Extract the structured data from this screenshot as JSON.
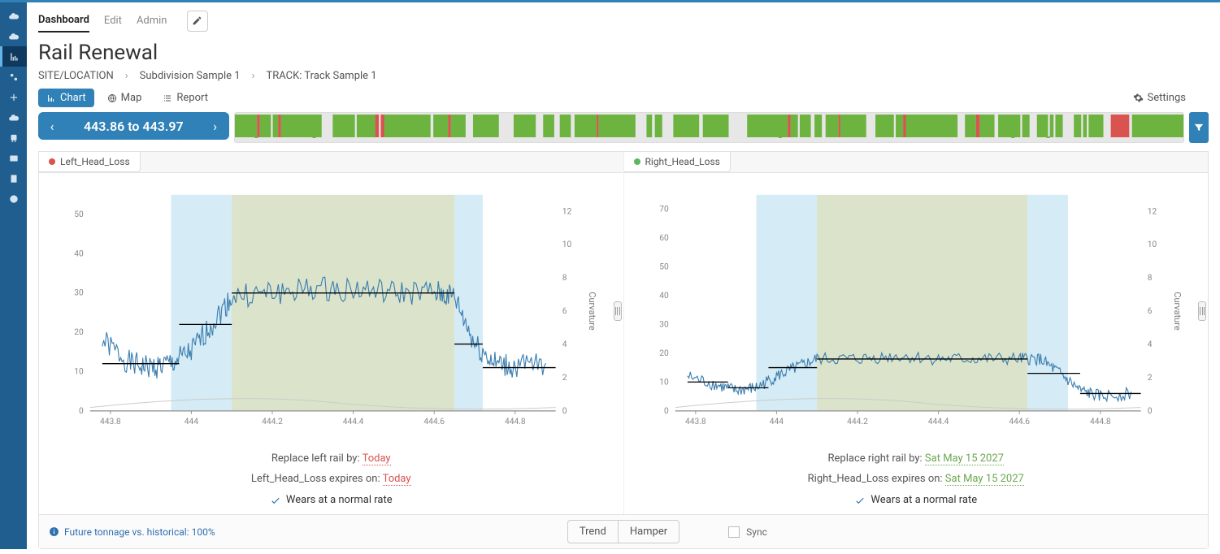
{
  "tabs": {
    "dashboard": "Dashboard",
    "edit": "Edit",
    "admin": "Admin"
  },
  "title": "Rail Renewal",
  "breadcrumb": {
    "site": "SITE/LOCATION",
    "sub": "Subdivision Sample 1",
    "track": "TRACK: Track Sample 1"
  },
  "views": {
    "chart": "Chart",
    "map": "Map",
    "report": "Report"
  },
  "settings": "Settings",
  "range": "443.86 to 443.97",
  "panels": {
    "left": {
      "tab": "Left_Head_Loss",
      "replace_label": "Replace left rail by: ",
      "replace_value": "Today",
      "expires_label": "Left_Head_Loss expires on: ",
      "expires_value": "Today",
      "wears": "Wears at a normal rate"
    },
    "right": {
      "tab": "Right_Head_Loss",
      "replace_label": "Replace right rail by: ",
      "replace_value": "Sat May 15 2027",
      "expires_label": "Right_Head_Loss expires on: ",
      "expires_value": "Sat May 15 2027",
      "wears": "Wears at a normal rate"
    }
  },
  "footer": {
    "info": "Future tonnage vs. historical: 100%",
    "trend": "Trend",
    "hamper": "Hamper",
    "sync": "Sync"
  },
  "right_axis_label": "Curvature",
  "chart_data": [
    {
      "type": "line",
      "title": "Left_Head_Loss",
      "xlabel": "",
      "ylabel": "",
      "x_ticks": [
        443.8,
        444,
        444.2,
        444.4,
        444.6,
        444.8
      ],
      "y_left_ticks": [
        0,
        10,
        20,
        30,
        40,
        50
      ],
      "y_right_ticks": [
        0,
        2,
        4,
        6,
        8,
        10,
        12
      ],
      "y_right_label": "Curvature",
      "xlim": [
        443.75,
        444.9
      ],
      "ylim_left": [
        0,
        55
      ],
      "ylim_right": [
        0,
        13
      ],
      "shaded_bands": [
        {
          "x0": 443.95,
          "x1": 444.1,
          "color": "#c7e4f2"
        },
        {
          "x0": 444.1,
          "x1": 444.65,
          "color": "#cfd9b8"
        },
        {
          "x0": 444.65,
          "x1": 444.72,
          "color": "#c7e4f2"
        }
      ],
      "series": [
        {
          "name": "head_loss_approx",
          "x": [
            443.78,
            443.85,
            443.9,
            443.95,
            444.0,
            444.05,
            444.1,
            444.2,
            444.3,
            444.4,
            444.5,
            444.6,
            444.65,
            444.7,
            444.75,
            444.8,
            444.88
          ],
          "y": [
            18,
            12,
            11,
            12,
            15,
            22,
            29,
            30,
            31,
            31,
            30,
            30,
            29,
            17,
            12,
            11,
            12
          ]
        }
      ],
      "step_segments": [
        {
          "x0": 443.78,
          "x1": 443.97,
          "y": 12
        },
        {
          "x0": 443.97,
          "x1": 444.1,
          "y": 22
        },
        {
          "x0": 444.1,
          "x1": 444.65,
          "y": 30
        },
        {
          "x0": 444.65,
          "x1": 444.72,
          "y": 17
        },
        {
          "x0": 444.72,
          "x1": 444.9,
          "y": 11
        }
      ],
      "baseline_y": 0
    },
    {
      "type": "line",
      "title": "Right_Head_Loss",
      "xlabel": "",
      "ylabel": "",
      "x_ticks": [
        443.8,
        444,
        444.2,
        444.4,
        444.6,
        444.8
      ],
      "y_left_ticks": [
        0,
        10,
        20,
        30,
        40,
        50,
        60,
        70
      ],
      "y_right_ticks": [
        0,
        2,
        4,
        6,
        8,
        10,
        12
      ],
      "y_right_label": "Curvature",
      "xlim": [
        443.75,
        444.9
      ],
      "ylim_left": [
        0,
        75
      ],
      "ylim_right": [
        0,
        13
      ],
      "shaded_bands": [
        {
          "x0": 443.95,
          "x1": 444.1,
          "color": "#c7e4f2"
        },
        {
          "x0": 444.1,
          "x1": 444.62,
          "color": "#cfd9b8"
        },
        {
          "x0": 444.62,
          "x1": 444.72,
          "color": "#c7e4f2"
        }
      ],
      "series": [
        {
          "name": "head_loss_approx",
          "x": [
            443.78,
            443.85,
            443.9,
            443.95,
            444.0,
            444.05,
            444.1,
            444.2,
            444.3,
            444.4,
            444.5,
            444.6,
            444.65,
            444.7,
            444.75,
            444.8,
            444.88
          ],
          "y": [
            12,
            9,
            7,
            8,
            12,
            15,
            18,
            18,
            19,
            18,
            18,
            18,
            18,
            13,
            7,
            5,
            6
          ]
        }
      ],
      "step_segments": [
        {
          "x0": 443.78,
          "x1": 443.88,
          "y": 10
        },
        {
          "x0": 443.88,
          "x1": 443.98,
          "y": 8
        },
        {
          "x0": 443.98,
          "x1": 444.1,
          "y": 15
        },
        {
          "x0": 444.1,
          "x1": 444.62,
          "y": 18
        },
        {
          "x0": 444.62,
          "x1": 444.75,
          "y": 13
        },
        {
          "x0": 444.75,
          "x1": 444.9,
          "y": 6
        }
      ],
      "baseline_y": 0
    }
  ],
  "strip_segments": [
    {
      "w": 1.2,
      "c": "g"
    },
    {
      "w": 0.15,
      "c": "r"
    },
    {
      "w": 0.6,
      "c": "g"
    },
    {
      "w": 0.1,
      "c": "x"
    },
    {
      "w": 0.3,
      "c": "g"
    },
    {
      "w": 0.15,
      "c": "r"
    },
    {
      "w": 2.2,
      "c": "g"
    },
    {
      "w": 0.6,
      "c": "x"
    },
    {
      "w": 1.2,
      "c": "g"
    },
    {
      "w": 0.1,
      "c": "x"
    },
    {
      "w": 1.0,
      "c": "g"
    },
    {
      "w": 0.2,
      "c": "r"
    },
    {
      "w": 0.1,
      "c": "x"
    },
    {
      "w": 0.2,
      "c": "r"
    },
    {
      "w": 2.5,
      "c": "g"
    },
    {
      "w": 0.15,
      "c": "x"
    },
    {
      "w": 0.8,
      "c": "g"
    },
    {
      "w": 0.15,
      "c": "r"
    },
    {
      "w": 0.8,
      "c": "g"
    },
    {
      "w": 0.4,
      "c": "x"
    },
    {
      "w": 1.4,
      "c": "g"
    },
    {
      "w": 0.8,
      "c": "x"
    },
    {
      "w": 1.2,
      "c": "g"
    },
    {
      "w": 0.4,
      "c": "x"
    },
    {
      "w": 0.6,
      "c": "g"
    },
    {
      "w": 0.3,
      "c": "x"
    },
    {
      "w": 0.6,
      "c": "g"
    },
    {
      "w": 0.2,
      "c": "x"
    },
    {
      "w": 1.2,
      "c": "g"
    },
    {
      "w": 0.1,
      "c": "r"
    },
    {
      "w": 2.0,
      "c": "g"
    },
    {
      "w": 0.6,
      "c": "x"
    },
    {
      "w": 0.3,
      "c": "g"
    },
    {
      "w": 0.15,
      "c": "x"
    },
    {
      "w": 0.4,
      "c": "g"
    },
    {
      "w": 0.6,
      "c": "x"
    },
    {
      "w": 1.4,
      "c": "g"
    },
    {
      "w": 0.2,
      "c": "x"
    },
    {
      "w": 1.4,
      "c": "g"
    },
    {
      "w": 1.0,
      "c": "x"
    },
    {
      "w": 2.2,
      "c": "g"
    },
    {
      "w": 0.15,
      "c": "r"
    },
    {
      "w": 0.4,
      "c": "g"
    },
    {
      "w": 0.1,
      "c": "x"
    },
    {
      "w": 0.6,
      "c": "g"
    },
    {
      "w": 0.2,
      "c": "x"
    },
    {
      "w": 0.4,
      "c": "g"
    },
    {
      "w": 0.2,
      "c": "x"
    },
    {
      "w": 0.7,
      "c": "g"
    },
    {
      "w": 0.1,
      "c": "r"
    },
    {
      "w": 1.4,
      "c": "g"
    },
    {
      "w": 0.5,
      "c": "x"
    },
    {
      "w": 1.0,
      "c": "g"
    },
    {
      "w": 0.1,
      "c": "x"
    },
    {
      "w": 0.4,
      "c": "g"
    },
    {
      "w": 0.15,
      "c": "r"
    },
    {
      "w": 2.8,
      "c": "g"
    },
    {
      "w": 0.4,
      "c": "x"
    },
    {
      "w": 0.6,
      "c": "g"
    },
    {
      "w": 0.2,
      "c": "r"
    },
    {
      "w": 0.8,
      "c": "g"
    },
    {
      "w": 0.2,
      "c": "x"
    },
    {
      "w": 1.2,
      "c": "g"
    },
    {
      "w": 0.1,
      "c": "x"
    },
    {
      "w": 0.4,
      "c": "g"
    },
    {
      "w": 0.4,
      "c": "x"
    },
    {
      "w": 0.6,
      "c": "g"
    },
    {
      "w": 0.1,
      "c": "x"
    },
    {
      "w": 0.2,
      "c": "g"
    },
    {
      "w": 0.1,
      "c": "x"
    },
    {
      "w": 0.4,
      "c": "g"
    },
    {
      "w": 0.6,
      "c": "x"
    },
    {
      "w": 0.4,
      "c": "g"
    },
    {
      "w": 0.1,
      "c": "x"
    },
    {
      "w": 0.2,
      "c": "g"
    },
    {
      "w": 0.1,
      "c": "x"
    },
    {
      "w": 0.8,
      "c": "g"
    },
    {
      "w": 0.4,
      "c": "x"
    },
    {
      "w": 1.0,
      "c": "r"
    },
    {
      "w": 0.15,
      "c": "x"
    },
    {
      "w": 2.8,
      "c": "g"
    }
  ]
}
